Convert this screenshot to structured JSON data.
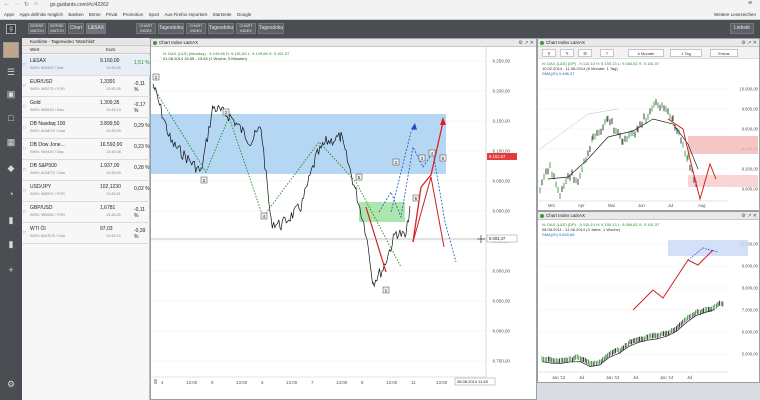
{
  "browser": {
    "url": "go.guidants.com/#c/42262",
    "bookmarks": [
      "Apps",
      "Apps definitiv möglich",
      "Banken",
      "Börse",
      "Privat",
      "Promotion",
      "Sport",
      "Aus Firefox importiert",
      "Startseite",
      "Google"
    ],
    "other_bookmarks": "Weitere Lesezeichen"
  },
  "toolbar": {
    "buttons": [
      {
        "label": "BÖRSE WATCH"
      },
      {
        "label": "BÖRSE WATCH"
      },
      {
        "label": "Chart"
      },
      {
        "label": "L&SAX"
      },
      {
        "label": "CHART INDEX"
      },
      {
        "label": "Tagesdoku"
      },
      {
        "label": "CHART INDEX"
      },
      {
        "label": "Tagesdoku"
      },
      {
        "label": "CHART INDEX"
      },
      {
        "label": "Tagesdoku"
      }
    ],
    "right_button": "Liebsté"
  },
  "watchlist": {
    "title": "Kursliste - Tagesvideo 'Watchlist'",
    "col_wert": "Wert",
    "col_kurs": "Kurs",
    "rows": [
      {
        "name": "L&SAX",
        "sub": "WKN: 846900 / Dax",
        "price": "9.150,00",
        "time": "13:45:26",
        "change": "1,51 %",
        "color": "#2a8a2a"
      },
      {
        "name": "EUR/USD",
        "sub": "WKN: 965275 / FOR",
        "price": "1,3391",
        "time": "13:45:26",
        "change": "-0,11 %",
        "color": "#222222"
      },
      {
        "name": "Gold",
        "sub": "WKN: 965515 / Dau",
        "price": "1.309,35",
        "time": "13:45:13",
        "change": "-0,17 %",
        "color": "#222222"
      },
      {
        "name": "DB Nasdaq 100",
        "sub": "WKN: A0AE1X / Dau",
        "price": "3.899,50",
        "time": "13:45:09",
        "change": "0,29 %",
        "color": "#222222"
      },
      {
        "name": "DB Dow Jone...",
        "sub": "WKN: 969420 / Dau",
        "price": "16.592,00",
        "time": "13:45:08",
        "change": "0,23 %",
        "color": "#222222"
      },
      {
        "name": "DB S&P500",
        "sub": "WKN: A0AET0 / Dau",
        "price": "1.937,00",
        "time": "13:45:09",
        "change": "0,28 %",
        "color": "#222222"
      },
      {
        "name": "USD/JPY",
        "sub": "WKN: 965991 / FOR",
        "price": "102,1230",
        "time": "13:45:21",
        "change": "0,02 %",
        "color": "#222222"
      },
      {
        "name": "GBP/USD",
        "sub": "WKN: 965986 / FOR",
        "price": "1,6781",
        "time": "13:45:26",
        "change": "-0,11 %",
        "color": "#222222"
      },
      {
        "name": "WTI Öl",
        "sub": "WKN: A0KRJS / Dau",
        "price": "97,03",
        "time": "13:45:10",
        "change": "-0,39 %",
        "color": "#222222"
      }
    ]
  },
  "main_chart": {
    "title": "Chart Index L&SAX",
    "legend1": "N: DAX (L&S) (intraday) - 9.149,66 H: 9.151,83 L: 9.149,66 S: 9.151,57",
    "legend2": "01.08.2014 15:55 - 13:45 (1 Woche, 5 Minuten)",
    "price_labels": [
      "9.250,00",
      "9.200,00",
      "9.150,00",
      "9.100,00",
      "9.050,00",
      "9.000,00",
      "8.950,00",
      "8.900,00",
      "8.850,00",
      "8.800,00",
      "8.750,00"
    ],
    "current_price": "9.151,57",
    "crosshair_price": "9.003,47",
    "x_labels": [
      "4",
      "13:00",
      "5",
      "13:00",
      "6",
      "13:00",
      "7",
      "13:00",
      "8",
      "13:00",
      "11",
      "13:00"
    ],
    "crosshair_time": "08.08.2014 11:45",
    "wave_labels": [
      "1",
      "2",
      "3",
      "4",
      "5",
      "5",
      "2",
      "3",
      "4",
      "5",
      "1"
    ]
  },
  "top_right_chart": {
    "title": "Chart Index L&SAX",
    "toolbar": [
      "6 Monate",
      "1 Tag",
      "Extras"
    ],
    "legend1": "N: DAX (L&S) (DP) - 9.110,10 H: 9.150,13 L: 9.084,82 S: 9.151,57",
    "legend2": "10.02.2014 - 11.08.2014 (6 Monate, 1 Tag)",
    "legend3": "SMA(20) 9.496,37",
    "price_labels": [
      "10.000,00",
      "9.800,00",
      "9.600,00",
      "9.400,00",
      "9.200,00",
      "9.000,00"
    ],
    "x_labels": [
      "Mrz",
      "Apr",
      "Mai",
      "Jun",
      "Jul",
      "Aug"
    ]
  },
  "bottom_right_chart": {
    "title": "Chart Index L&SAX",
    "legend1": "N: DAX (L&S) (DP) - 9.110,10 H: 9.150,13 L: 9.084,82 S: 9.151,57",
    "legend2": "08.08.2011 - 11.08.2014 (3 Jahre, 1 Woche)",
    "legend3": "SMA(20) 9.620,65",
    "price_labels": [
      "10.000,00",
      "9.000,00",
      "8.000,00",
      "7.000,00",
      "6.000,00",
      "5.000,00"
    ],
    "x_labels": [
      "Jan '12",
      "Jul",
      "Jan '13",
      "Jul",
      "Jan '14",
      "Jul"
    ]
  }
}
